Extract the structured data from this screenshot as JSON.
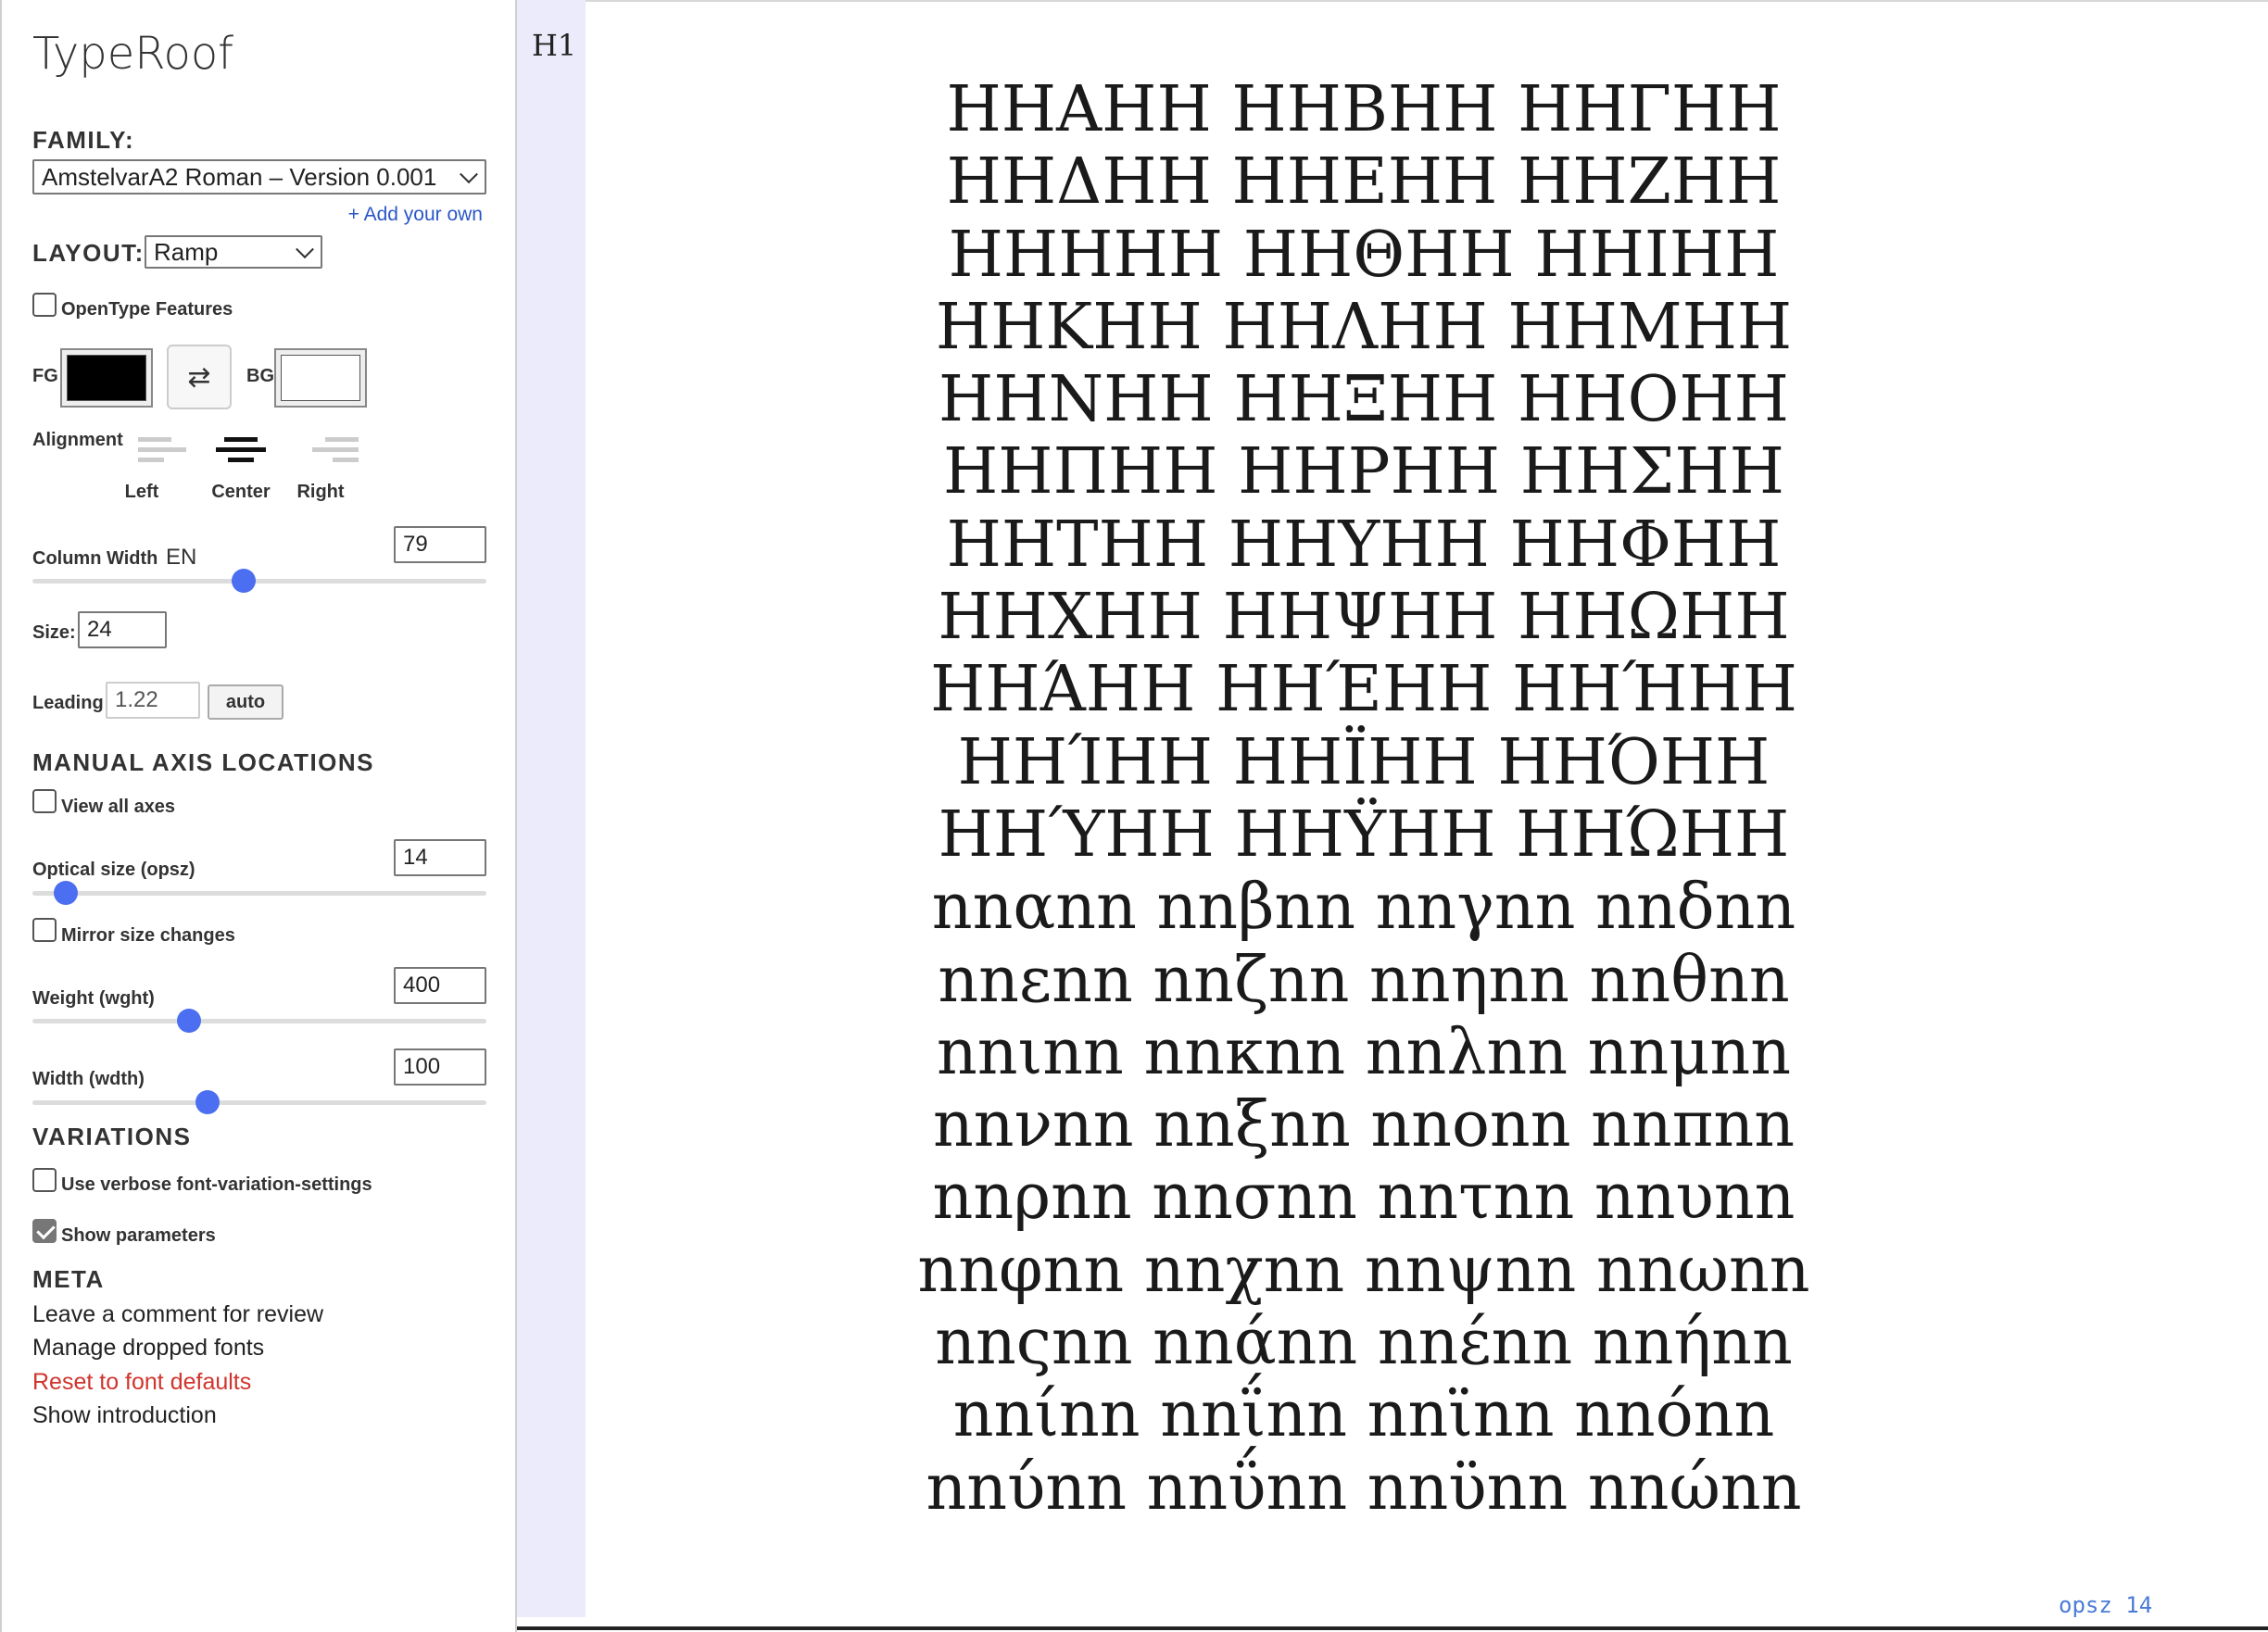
{
  "app": {
    "title": "TypeRoof"
  },
  "family": {
    "label": "FAMILY:",
    "selected": "AmstelvarA2 Roman – Version 0.001",
    "add_link": "+ Add your own"
  },
  "layout": {
    "label": "LAYOUT:",
    "selected": "Ramp"
  },
  "opentype": {
    "label": "OpenType Features",
    "checked": false
  },
  "colors": {
    "fg_label": "FG",
    "bg_label": "BG",
    "fg_color": "#000000",
    "bg_color": "#ffffff",
    "swap_icon": "swap-arrows-icon",
    "swap_glyph": "⇄"
  },
  "alignment": {
    "label": "Alignment",
    "options": [
      "Left",
      "Center",
      "Right"
    ],
    "selected": "Center"
  },
  "column_width": {
    "label": "Column Width",
    "unit": "EN",
    "value": "79",
    "slider_fraction": 0.46
  },
  "size": {
    "label": "Size:",
    "value": "24"
  },
  "leading": {
    "label": "Leading",
    "value": "1.22",
    "auto_label": "auto"
  },
  "axes": {
    "title": "MANUAL AXIS LOCATIONS",
    "view_all": {
      "label": "View all axes",
      "checked": false
    },
    "opsz": {
      "label": "Optical size (opsz)",
      "value": "14",
      "slider_fraction": 0.07
    },
    "mirror": {
      "label": "Mirror size changes",
      "checked": false
    },
    "wght": {
      "label": "Weight (wght)",
      "value": "400",
      "slider_fraction": 0.34
    },
    "wdth": {
      "label": "Width (wdth)",
      "value": "100",
      "slider_fraction": 0.38
    }
  },
  "variations": {
    "title": "VARIATIONS",
    "verbose": {
      "label": "Use verbose font-variation-settings",
      "checked": false
    },
    "show_params": {
      "label": "Show parameters",
      "checked": true
    }
  },
  "meta": {
    "title": "META",
    "links": [
      {
        "label": "Leave a comment for review",
        "style": "normal"
      },
      {
        "label": "Manage dropped fonts",
        "style": "normal"
      },
      {
        "label": "Reset to font defaults",
        "style": "red"
      },
      {
        "label": "Show introduction",
        "style": "normal"
      }
    ]
  },
  "stage": {
    "gutter_label": "H1",
    "lines": [
      "HHΑHH HHΒHH HHΓHH",
      "HHΔHH HHΕHH HHΖHH",
      "HHΗHH HHΘHH HHΙHH",
      "HHΚHH HHΛHH HHΜHH",
      "HHΝHH HHΞHH HHΟHH",
      "HHΠHH HHΡHH HHΣHH",
      "HHΤHH HHΥHH HHΦHH",
      "HHΧHH HHΨHH HHΩHH",
      "HHΆHH HHΈHH HHΉHH",
      "HHΊHH HHΪHH HHΌHH",
      "HHΎHH HHΫHH HHΏHH",
      "nnαnn nnβnn nnγnn nnδnn",
      "nnεnn nnζnn nnηnn nnθnn",
      "nnιnn nnκnn nnλnn nnμnn",
      "nnνnn nnξnn nnοnn nnπnn",
      "nnρnn nnσnn nnτnn nnυnn",
      "nnφnn nnχnn nnψnn nnωnn",
      "nnςnn nnάnn nnέnn nnήnn",
      "nnίnn nnΐnn nnϊnn nnόnn",
      "nnύnn nnΰnn nnϋnn nnώnn"
    ],
    "opsz_badge": "opsz 14"
  }
}
